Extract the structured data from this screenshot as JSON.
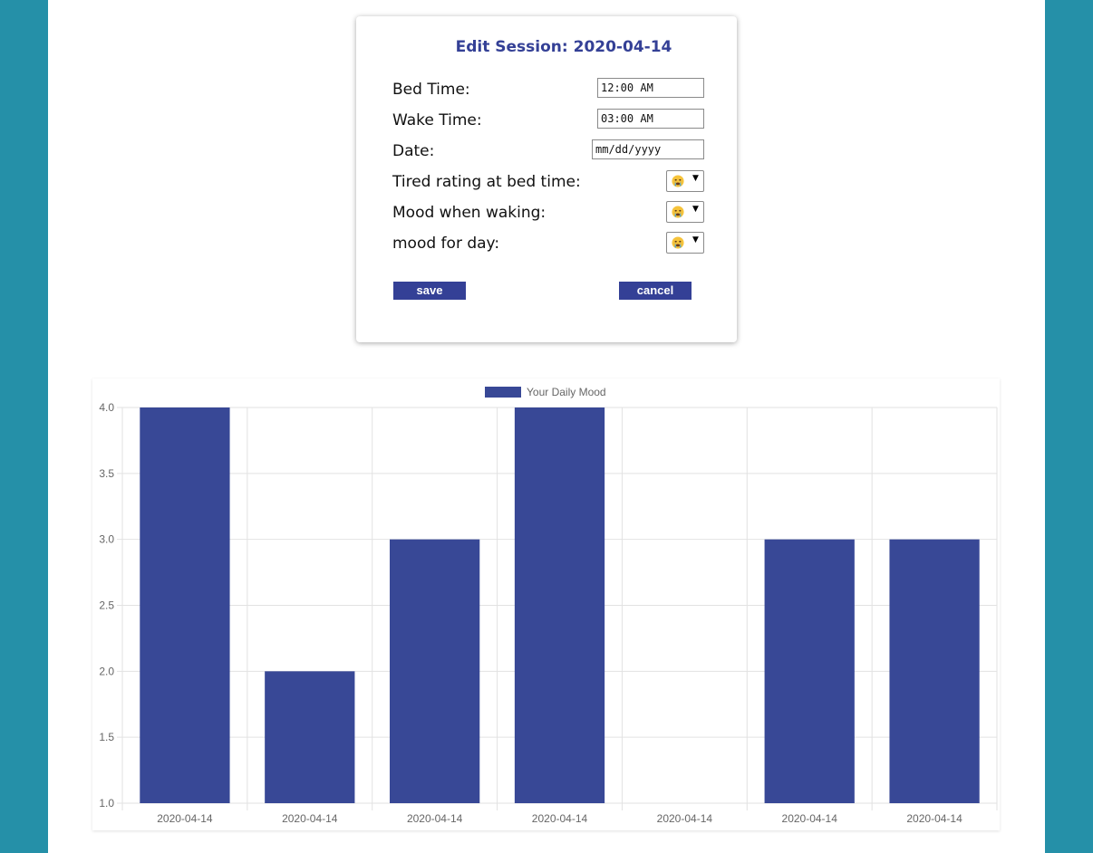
{
  "edit_session": {
    "title": "Edit Session: 2020-04-14",
    "fields": {
      "bed_time": {
        "label": "Bed Time:",
        "value": "12:00  AM"
      },
      "wake_time": {
        "label": "Wake Time:",
        "value": "03:00  AM"
      },
      "date": {
        "label": "Date:",
        "placeholder": "mm/dd/yyyy"
      },
      "tired_rating": {
        "label": "Tired rating at bed time:",
        "icon": "crying-face-icon"
      },
      "mood_waking": {
        "label": "Mood when waking:",
        "icon": "crying-face-icon"
      },
      "mood_day": {
        "label": "mood for day:",
        "icon": "crying-face-icon"
      }
    },
    "save_label": "save",
    "cancel_label": "cancel"
  },
  "colors": {
    "brand": "#344096",
    "page_background": "#2590a8",
    "bar_fill": "#384896"
  },
  "chart_data": {
    "type": "bar",
    "categories": [
      "2020-04-14",
      "2020-04-14",
      "2020-04-14",
      "2020-04-14",
      "2020-04-14",
      "2020-04-14",
      "2020-04-14"
    ],
    "series": [
      {
        "name": "Your Daily Mood",
        "values": [
          4,
          2,
          3,
          4,
          1,
          3,
          3
        ]
      }
    ],
    "ylim": [
      1,
      4
    ],
    "yticks": [
      "1.0",
      "1.5",
      "2.0",
      "2.5",
      "3.0",
      "3.5",
      "4.0"
    ],
    "grid": true,
    "legend": "top-center"
  }
}
